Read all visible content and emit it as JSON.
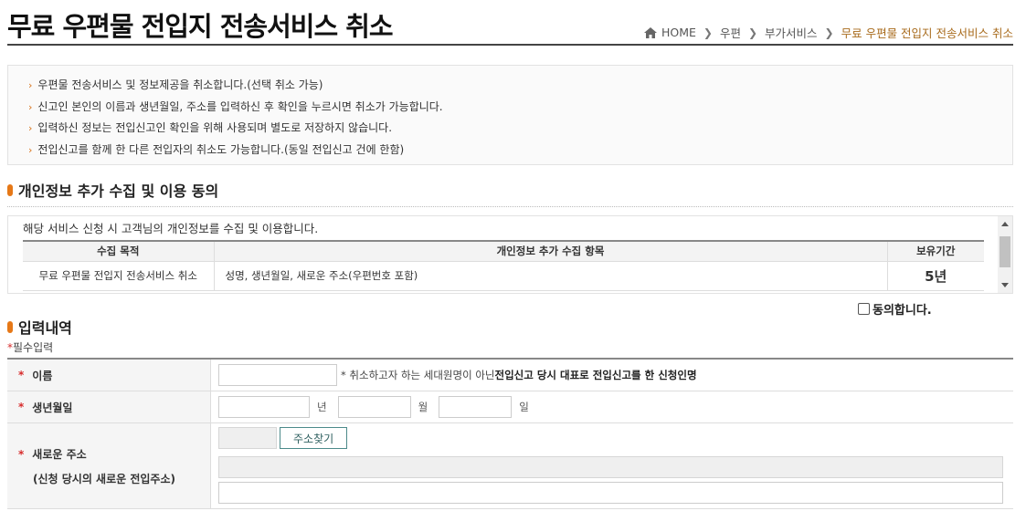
{
  "page": {
    "title": "무료 우편물 전입지 전송서비스 취소"
  },
  "breadcrumb": {
    "home": "HOME",
    "items": [
      "우편",
      "부가서비스"
    ],
    "current": "무료 우편물 전입지 전송서비스 취소"
  },
  "notice": [
    "우편물 전송서비스 및 정보제공을 취소합니다.(선택 취소 가능)",
    "신고인 본인의 이름과 생년월일, 주소를 입력하신 후 확인을 누르시면 취소가 가능합니다.",
    "입력하신 정보는 전입신고인 확인을 위해 사용되며 별도로 저장하지 않습니다.",
    "전입신고를 함께 한 다른 전입자의 취소도 가능합니다.(동일 전입신고 건에 한함)"
  ],
  "consent": {
    "heading": "개인정보 추가 수집 및 이용 동의",
    "intro": "해당 서비스 신청 시 고객님의 개인정보를 수집 및 이용합니다.",
    "columns": [
      "수집 목적",
      "개인정보 추가 수집 항목",
      "보유기간"
    ],
    "row": {
      "purpose": "무료 우편물 전입지 전송서비스 취소",
      "items": "성명, 생년월일, 새로운 주소(우편번호 포함)",
      "period": "5년"
    },
    "agree_label": "동의합니다."
  },
  "form": {
    "heading": "입력내역",
    "required_star": "*",
    "required_note": "필수입력",
    "name": {
      "label": "이름",
      "note_prefix": "* 취소하고자 하는 세대원명이 아닌 ",
      "note_strong": "전입신고 당시 대표로 전입신고를 한 신청인명",
      "value": ""
    },
    "birth": {
      "label": "생년월일",
      "year_unit": "년",
      "month_unit": "월",
      "day_unit": "일"
    },
    "address": {
      "label": "새로운 주소",
      "sublabel": "(신청 당시의 새로운 전입주소)",
      "find_button": "주소찾기"
    }
  },
  "colors": {
    "accent": "#e67817",
    "breadcrumb_current": "#a86b1c",
    "required": "#d72c2c"
  }
}
